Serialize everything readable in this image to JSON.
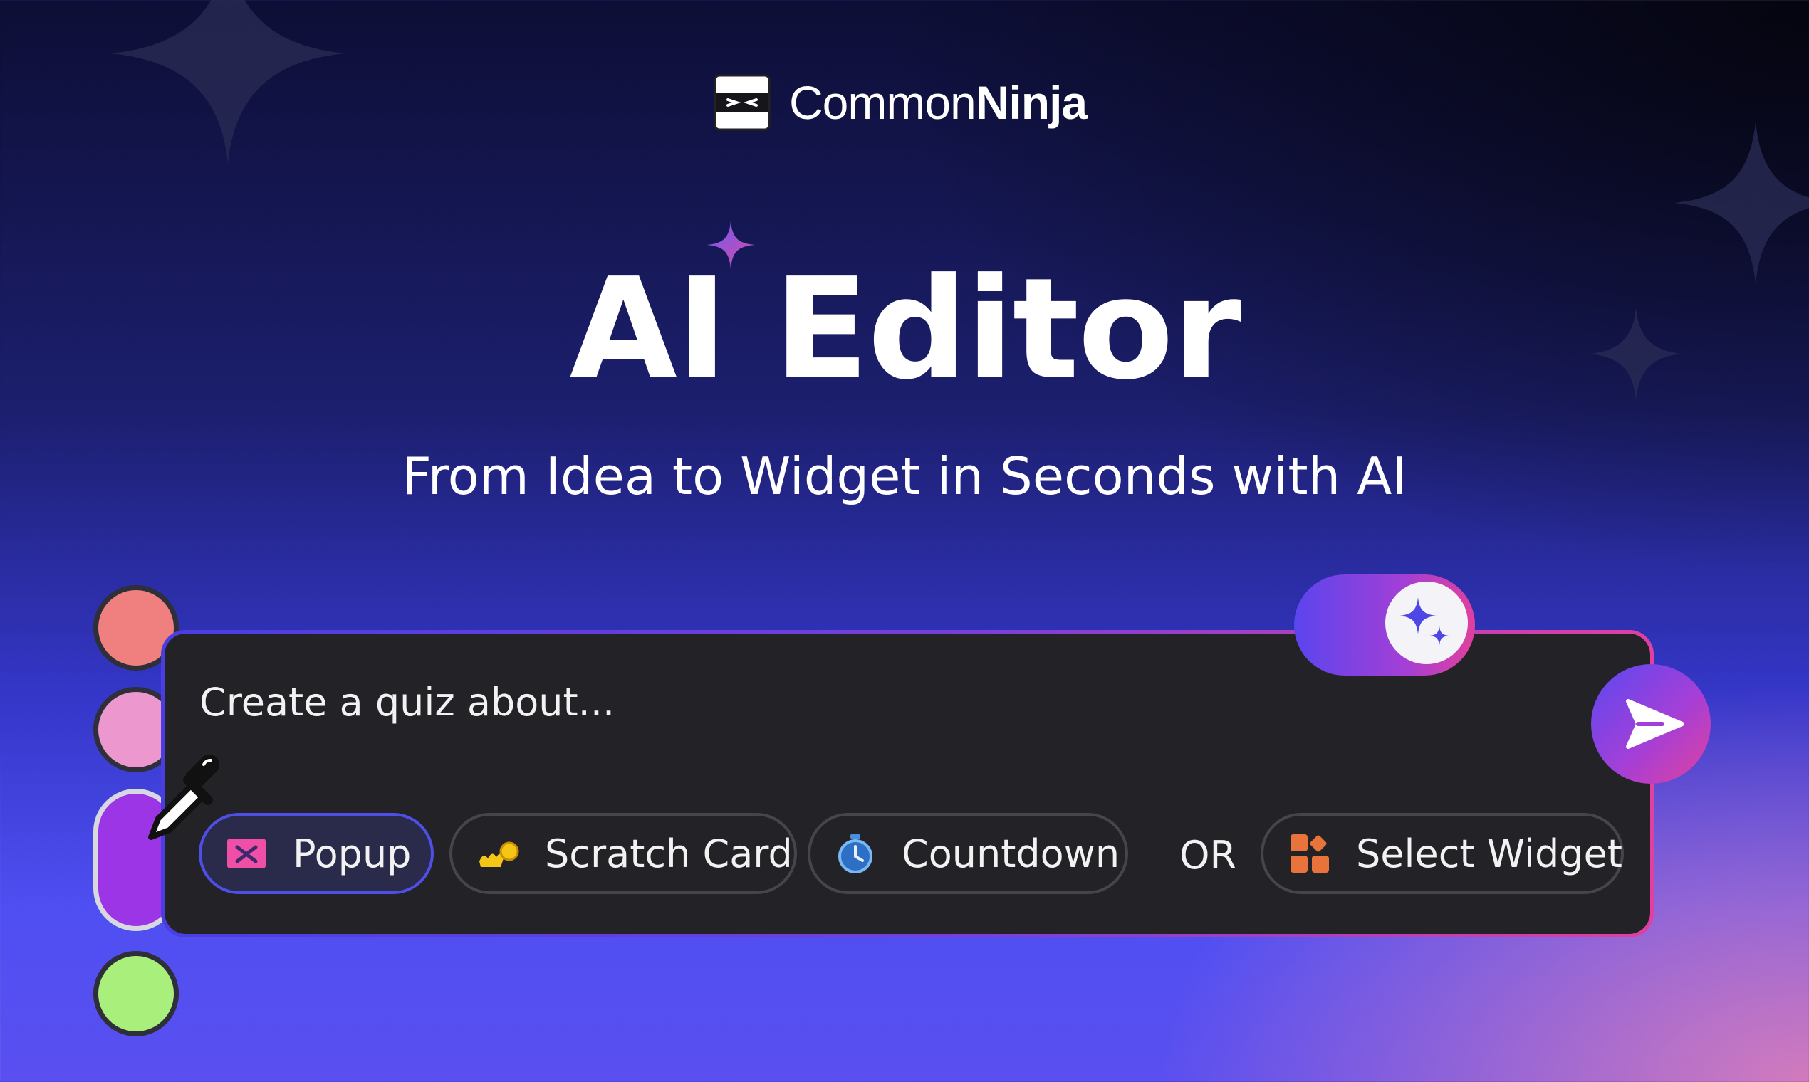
{
  "brand": {
    "name_regular": "Common",
    "name_bold": "Ninja",
    "logo_icon": "ninja-mask-logo"
  },
  "hero": {
    "title": "AI Editor",
    "subtitle": "From Idea to Widget in Seconds with AI"
  },
  "editor": {
    "prompt_text": "Create a quiz about...",
    "ai_toggle_icon": "sparkles-icon",
    "send_icon": "send-arrow-icon",
    "chips": [
      {
        "label": "Popup",
        "icon": "popup-icon",
        "active": true
      },
      {
        "label": "Scratch Card",
        "icon": "scratch-card-icon",
        "active": false
      },
      {
        "label": "Countdown",
        "icon": "stopwatch-icon",
        "active": false
      }
    ],
    "or_label": "OR",
    "select_widget": {
      "label": "Select Widget",
      "icon": "widgets-grid-icon"
    }
  },
  "color_swatches": [
    "#f08080",
    "#ec98cf",
    "#9b35e6",
    "#a8ef7c"
  ],
  "colors": {
    "accent_purple": "#5a45ee",
    "accent_pink": "#e0409e",
    "panel_bg": "#232327"
  }
}
